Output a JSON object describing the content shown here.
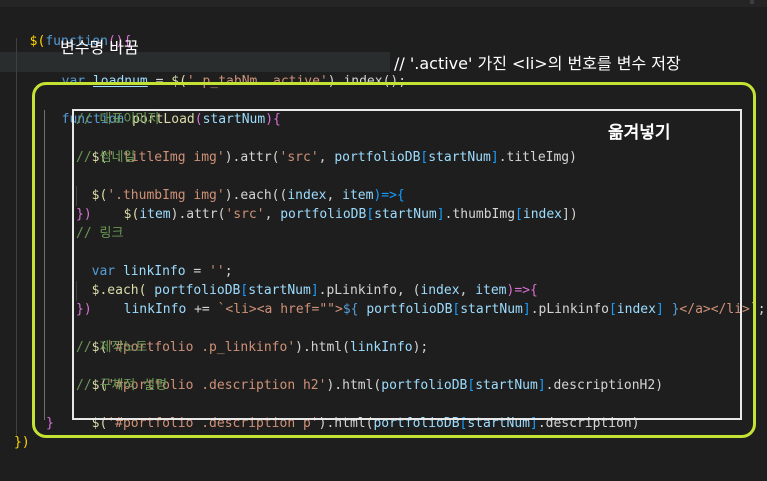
{
  "editor": {
    "annotations": {
      "var_name_label": "변수명 바꿈",
      "move_label": "옮겨넣기",
      "index_note": "// '.active' 가진 <li>의 번호를 변수 저장"
    },
    "lines": {
      "l1_kw": "$(",
      "l1_fn": "function",
      "l1_paren": "(){",
      "l2_var_kw": "var",
      "l2_name": "loadnum",
      "l2_eq": " = ",
      "l2_sel_open": "$(",
      "l2_str": "'.p_tabNm .active'",
      "l2_rest": ").index();",
      "l3_kw": "function",
      "l3_name": "portLoad",
      "l3_param": "startNum",
      "c1": "// 대표이미지",
      "l5_a": "$(",
      "l5_str": "'.titleImg img'",
      "l5_b": ").attr(",
      "l5_str2": "'src'",
      "l5_c": ", ",
      "l5_db": "portfolioDB",
      "l5_idx": "startNum",
      "l5_d": ".titleImg)",
      "c2": "// 썸네일",
      "l7_a": "$(",
      "l7_str": "'.thumbImg img'",
      "l7_b": ").each((",
      "l7_p1": "index",
      "l7_p2": "item",
      "l7_c": ")=>{",
      "l8_a": "$(",
      "l8_item": "item",
      "l8_b": ").attr(",
      "l8_str": "'src'",
      "l8_db": "portfolioDB",
      "l8_idx": "startNum",
      "l8_c": ".thumbImg",
      "l8_idx2": "index",
      "l8_d": "])",
      "l9": "})",
      "c3": "// 링크",
      "l11_kw": "var",
      "l11_name": "linkInfo",
      "l11_str": "''",
      "l12_a": "$.each(",
      "l12_db": "portfolioDB",
      "l12_idx": "startNum",
      "l12_b": ".pLinkinfo, (",
      "l12_p1": "index",
      "l12_p2": "item",
      "l12_c": ")=>{",
      "l13_name": "linkInfo",
      "l13_op": " += ",
      "l13_str1": "`<li><a href=\"\">",
      "l13_tpl": "${ ",
      "l13_db": "portfolioDB",
      "l13_idx": "startNum",
      "l13_mid": ".pLinkinfo",
      "l13_idx2": "index",
      "l13_tplend": " }",
      "l13_str2": "</a></li>`",
      "l13_end": ";",
      "l14": "})",
      "l15_a": "$(",
      "l15_str": "'#portfolio .p_linkinfo'",
      "l15_b": ").html(",
      "l15_var": "linkInfo",
      "l15_c": ");",
      "c4": "// 제작노트",
      "l17_a": "$(",
      "l17_str": "'#portfolio .description h2'",
      "l17_b": ").html(",
      "l17_db": "portfolioDB",
      "l17_idx": "startNum",
      "l17_c": ".descriptionH2)",
      "c5": "// 구체적 설명",
      "l19_a": "$(",
      "l19_str": "'#portfolio .description p'",
      "l19_b": ").html(",
      "l19_db": "portfolioDB",
      "l19_idx": "startNum",
      "l19_c": ".description)",
      "l20": "}",
      "l21": "})"
    }
  }
}
